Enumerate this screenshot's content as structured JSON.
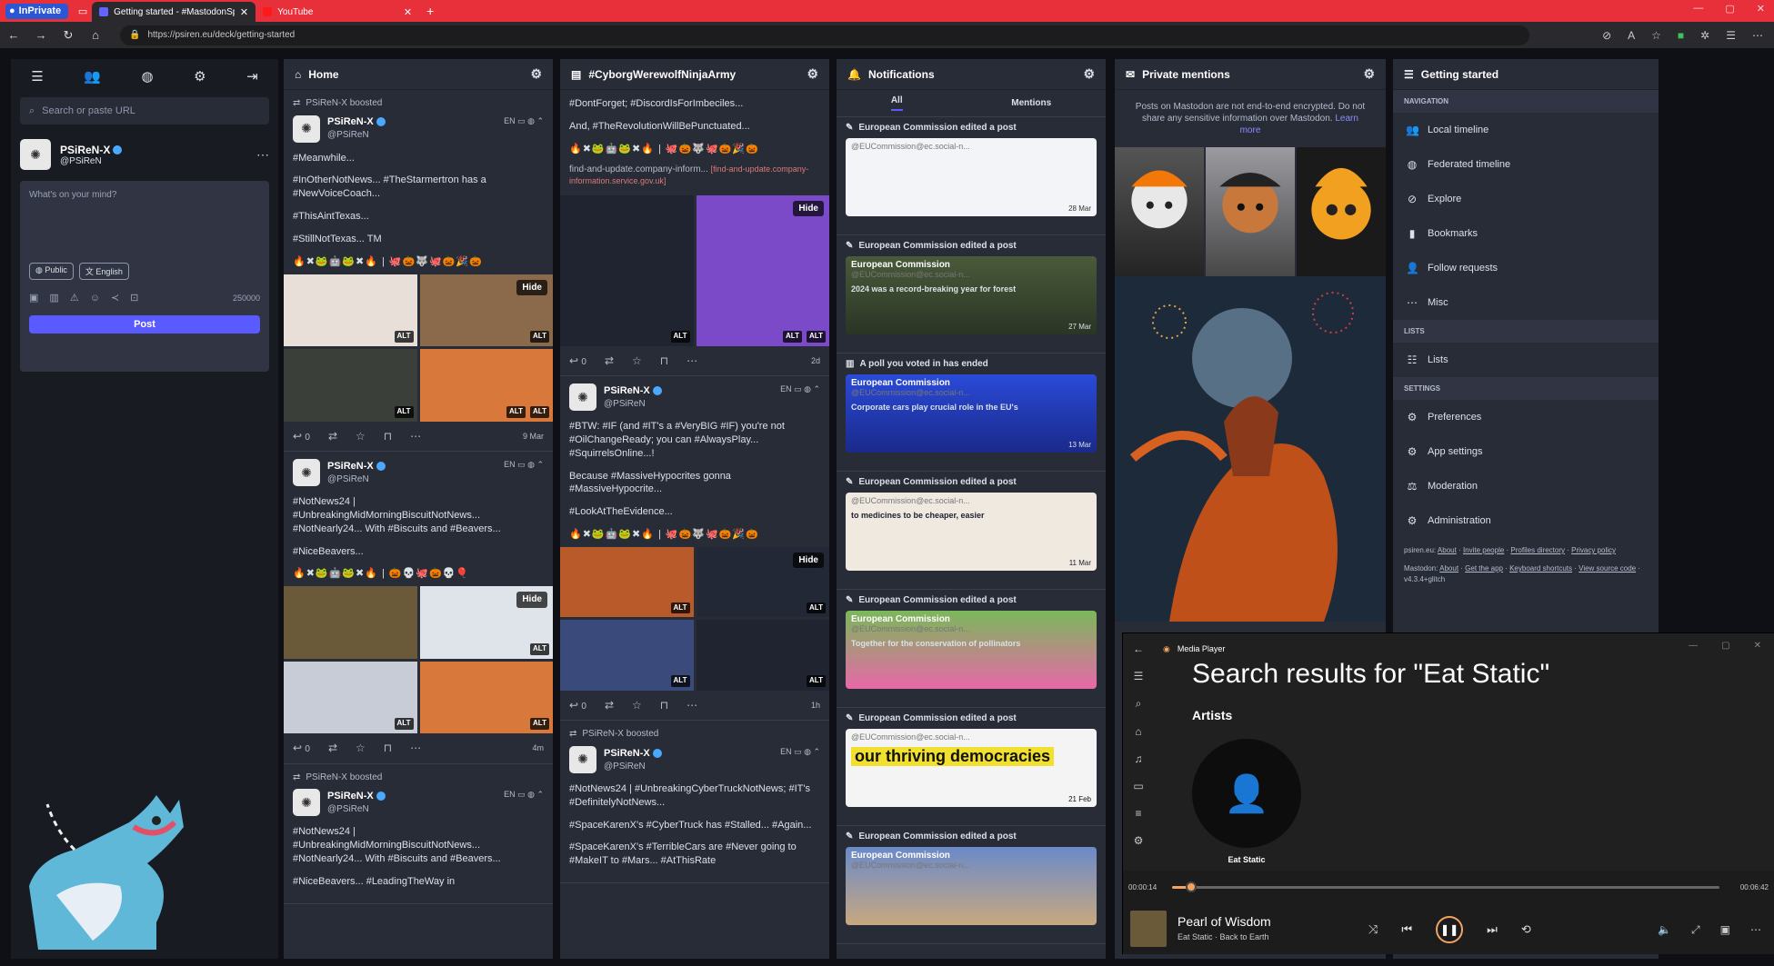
{
  "browser": {
    "inprivate": "InPrivate",
    "tabs": [
      {
        "label": "Getting started - #MastodonSpy",
        "active": true
      },
      {
        "label": "YouTube",
        "active": false
      }
    ],
    "url": "https://psiren.eu/deck/getting-started"
  },
  "compose": {
    "search_placeholder": "Search or paste URL",
    "user_name": "PSiReN-X",
    "user_handle": "@PSiReN",
    "placeholder": "What's on your mind?",
    "visibility": "Public",
    "language": "English",
    "char_count": "250000",
    "post_label": "Post"
  },
  "home": {
    "title": "Home",
    "statuses": [
      {
        "boost": "PSiReN-X boosted",
        "name": "PSiReN-X",
        "handle": "@PSiReN",
        "lang": "EN",
        "p1": "#Meanwhile...",
        "p2": "#InOtherNotNews... #TheStarmertron has a #NewVoiceCoach...",
        "p3": "#ThisAintTexas...",
        "p4": "#StillNotTexas... TM",
        "replies": "0",
        "time": "9 Mar"
      },
      {
        "name": "PSiReN-X",
        "handle": "@PSiReN",
        "lang": "EN",
        "p1": "#NotNews24 | #UnbreakingMidMorningBiscuitNotNews... #NotNearly24... With #Biscuits and #Beavers...",
        "p2": "#NiceBeavers...",
        "replies": "0",
        "time": "4m"
      },
      {
        "boost": "PSiReN-X boosted",
        "name": "PSiReN-X",
        "handle": "@PSiReN",
        "lang": "EN",
        "p1": "#NotNews24 | #UnbreakingMidMorningBiscuitNotNews... #NotNearly24... With #Biscuits and #Beavers...",
        "p2": "#NiceBeavers... #LeadingTheWay in"
      }
    ]
  },
  "hashtag": {
    "title": "#CyborgWerewolfNinjaArmy",
    "top_text1": "#DontForget; #DiscordIsForImbeciles...",
    "top_text2": "And, #TheRevolutionWillBePunctuated...",
    "link_text": "find-and-update.company-inform...",
    "link_url": "[find-and-update.company-information.service.gov.uk]",
    "time1": "2d",
    "replies1": "0",
    "status2": {
      "name": "PSiReN-X",
      "handle": "@PSiReN",
      "lang": "EN",
      "p1": "#BTW: #IF (and #IT's a #VeryBIG #IF) you're not #OilChangeReady; you can #AlwaysPlay... #SquirrelsOnline...!",
      "p2": "Because #MassiveHypocrites gonna #MassiveHypocrite...",
      "p3": "#LookAtTheEvidence...",
      "replies": "0",
      "time": "1h"
    },
    "status3": {
      "boost": "PSiReN-X boosted",
      "name": "PSiReN-X",
      "handle": "@PSiReN",
      "lang": "EN",
      "p1": "#NotNews24 | #UnbreakingCyberTruckNotNews; #IT's #DefinitelyNotNews...",
      "p2": "#SpaceKarenX's #CyberTruck has #Stalled... #Again...",
      "p3": "#SpaceKarenX's #TerribleCars are #Never going to #MakeIT to #Mars... #AtThisRate"
    }
  },
  "notifications": {
    "title": "Notifications",
    "tab_all": "All",
    "tab_mentions": "Mentions",
    "items": [
      {
        "title": "European Commission edited a post",
        "card_name": "",
        "handle": "@EUCommission@ec.social-n...",
        "time": "28 Mar",
        "overlay": "",
        "style": "light"
      },
      {
        "title": "European Commission edited a post",
        "card_name": "European Commission",
        "handle": "@EUCommission@ec.social-n...",
        "time": "27 Mar",
        "overlay": "2024 was a record-breaking year for forest",
        "style": "forest"
      },
      {
        "title": "A poll you voted in has ended",
        "card_name": "European Commission",
        "handle": "@EUCommission@ec.social-n...",
        "time": "13 Mar",
        "overlay": "Corporate cars play crucial role in the EU's",
        "style": "blue"
      },
      {
        "title": "European Commission edited a post",
        "card_name": "",
        "handle": "@EUCommission@ec.social-n...",
        "time": "11 Mar",
        "overlay": "to medicines to be cheaper, easier",
        "style": "paper"
      },
      {
        "title": "European Commission edited a post",
        "card_name": "European Commission",
        "handle": "@EUCommission@ec.social-n...",
        "time": "",
        "overlay": "Together for the conservation of pollinators",
        "style": "flower"
      },
      {
        "title": "European Commission edited a post",
        "card_name": "",
        "handle": "@EUCommission@ec.social-n...",
        "time": "21 Feb",
        "overlay": "our thriving democracies",
        "style": "yellow"
      },
      {
        "title": "European Commission edited a post",
        "card_name": "European Commission",
        "handle": "@EUCommission@ec.social-n...",
        "time": "",
        "overlay": "",
        "style": "house"
      }
    ]
  },
  "private": {
    "title": "Private mentions",
    "note": "Posts on Mastodon are not end-to-end encrypted. Do not share any sensitive information over Mastodon.",
    "learn_more": "Learn more"
  },
  "getting_started": {
    "title": "Getting started",
    "sec_nav": "Navigation",
    "nav": [
      "Local timeline",
      "Federated timeline",
      "Explore",
      "Bookmarks",
      "Follow requests",
      "Misc"
    ],
    "sec_lists": "Lists",
    "lists": "Lists",
    "sec_settings": "Settings",
    "settings": [
      "Preferences",
      "App settings",
      "Moderation",
      "Administration"
    ],
    "footer1_site": "psiren.eu:",
    "footer1_links": [
      "About",
      "Invite people",
      "Profiles directory",
      "Privacy policy"
    ],
    "footer2_site": "Mastodon:",
    "footer2_links": [
      "About",
      "Get the app",
      "Keyboard shortcuts",
      "View source code"
    ],
    "version": "v4.3.4+glitch"
  },
  "media_player": {
    "app_title": "Media Player",
    "heading": "Search results for \"Eat Static\"",
    "section": "Artists",
    "artist": "Eat Static",
    "elapsed": "00:00:14",
    "total": "00:06:42",
    "progress": 0.035,
    "song": "Pearl of Wisdom",
    "song_sub": "Eat Static · Back to Earth",
    "accent": "#f2a35f"
  }
}
